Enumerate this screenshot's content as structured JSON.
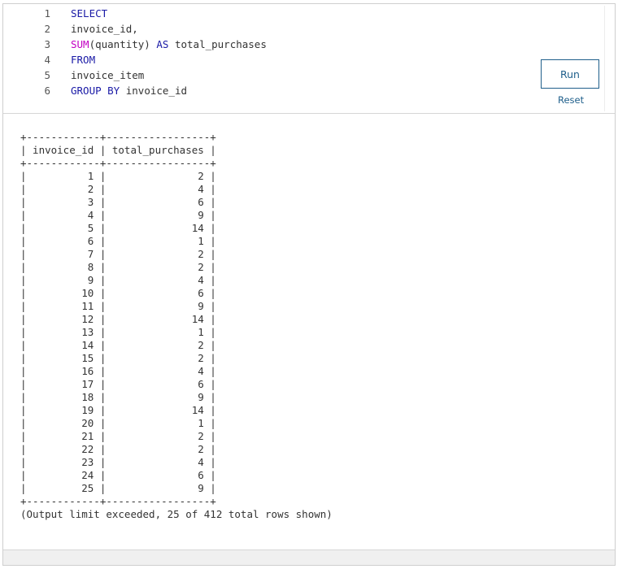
{
  "editor": {
    "lines": [
      {
        "num": "1",
        "parts": [
          {
            "t": "SELECT",
            "c": "kw"
          }
        ]
      },
      {
        "num": "2",
        "parts": [
          {
            "t": "invoice_id,",
            "c": ""
          }
        ]
      },
      {
        "num": "3",
        "parts": [
          {
            "t": "SUM",
            "c": "fn"
          },
          {
            "t": "(quantity) ",
            "c": ""
          },
          {
            "t": "AS",
            "c": "kw"
          },
          {
            "t": " total_purchases",
            "c": ""
          }
        ]
      },
      {
        "num": "4",
        "parts": [
          {
            "t": "FROM",
            "c": "kw"
          }
        ]
      },
      {
        "num": "5",
        "parts": [
          {
            "t": "invoice_item",
            "c": ""
          }
        ]
      },
      {
        "num": "6",
        "parts": [
          {
            "t": "GROUP BY",
            "c": "kw"
          },
          {
            "t": " invoice_id",
            "c": ""
          }
        ]
      }
    ]
  },
  "controls": {
    "run_label": "Run",
    "reset_label": "Reset"
  },
  "output": {
    "columns": [
      "invoice_id",
      "total_purchases"
    ],
    "rows": [
      [
        "1",
        "2"
      ],
      [
        "2",
        "4"
      ],
      [
        "3",
        "6"
      ],
      [
        "4",
        "9"
      ],
      [
        "5",
        "14"
      ],
      [
        "6",
        "1"
      ],
      [
        "7",
        "2"
      ],
      [
        "8",
        "2"
      ],
      [
        "9",
        "4"
      ],
      [
        "10",
        "6"
      ],
      [
        "11",
        "9"
      ],
      [
        "12",
        "14"
      ],
      [
        "13",
        "1"
      ],
      [
        "14",
        "2"
      ],
      [
        "15",
        "2"
      ],
      [
        "16",
        "4"
      ],
      [
        "17",
        "6"
      ],
      [
        "18",
        "9"
      ],
      [
        "19",
        "14"
      ],
      [
        "20",
        "1"
      ],
      [
        "21",
        "2"
      ],
      [
        "22",
        "2"
      ],
      [
        "23",
        "4"
      ],
      [
        "24",
        "6"
      ],
      [
        "25",
        "9"
      ]
    ],
    "notice": "(Output limit exceeded, 25 of 412 total rows shown)"
  },
  "colors": {
    "keyword": "#1a1aa6",
    "function": "#c300c3",
    "button": "#1f5f8b"
  }
}
